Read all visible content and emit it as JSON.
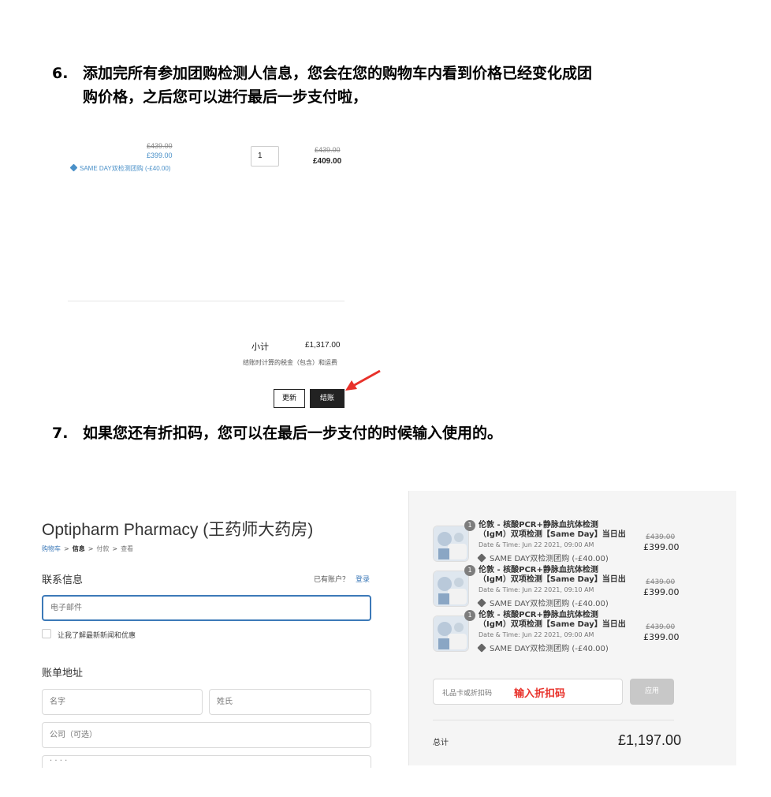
{
  "step6": {
    "number": "6.",
    "line1": "添加完所有参加团购检测人信息，您会在您的购物车内看到价格已经变化成团",
    "line2": "购价格，之后您可以进行最后一步支付啦，"
  },
  "cart": {
    "unit_old_price": "£439.00",
    "unit_new_price": "£399.00",
    "discount_label": "SAME DAY双检测团购 (-£40.00)",
    "quantity": "1",
    "line_old_total": "£439.00",
    "line_new_total": "£409.00",
    "subtotal_label": "小计",
    "subtotal_value": "£1,317.00",
    "tax_note": "结账时计算的税金（包含）和运费",
    "update_label": "更新",
    "checkout_label": "结账"
  },
  "step7": {
    "number": "7.",
    "line1": "如果您还有折扣码，您可以在最后一步支付的时候输入使用的。"
  },
  "checkout": {
    "shop_title": "Optipharm Pharmacy (王药师大药房)",
    "breadcrumb": [
      {
        "label": "购物车",
        "color": "#3c79b8"
      },
      {
        "label": ">",
        "color": "#555"
      },
      {
        "label": "信息",
        "color": "#222"
      },
      {
        "label": ">",
        "color": "#555"
      },
      {
        "label": "付款",
        "color": "#777"
      },
      {
        "label": ">",
        "color": "#555"
      },
      {
        "label": "查看",
        "color": "#777"
      }
    ],
    "contact_heading": "联系信息",
    "have_account": "已有账户？",
    "login_label": "登录",
    "email_placeholder": "电子邮件",
    "newsletter_label": "让我了解最新新闻和优惠",
    "billing_heading": "账单地址",
    "first_name_placeholder": "名字",
    "last_name_placeholder": "姓氏",
    "company_placeholder": "公司（可选）",
    "address_placeholder": "· · · ·"
  },
  "summary": {
    "items": [
      {
        "qty": "1",
        "name_line1": "伦敦 - 核酸PCR+静脉血抗体检测",
        "name_line2": "（IgM）双项检测【Same Day】当日出",
        "date": "Date & Time: Jun 22 2021, 09:00 AM",
        "discount": "SAME DAY双检测团购 (-£40.00)",
        "old_price": "£439.00",
        "new_price": "£399.00"
      },
      {
        "qty": "1",
        "name_line1": "伦敦 - 核酸PCR+静脉血抗体检测",
        "name_line2": "（IgM）双项检测【Same Day】当日出",
        "date": "Date & Time: Jun 22 2021, 09:10 AM",
        "discount": "SAME DAY双检测团购 (-£40.00)",
        "old_price": "£439.00",
        "new_price": "£399.00"
      },
      {
        "qty": "1",
        "name_line1": "伦敦 - 核酸PCR+静脉血抗体检测",
        "name_line2": "（IgM）双项检测【Same Day】当日出",
        "date": "Date & Time: Jun 22 2021, 09:00 AM",
        "discount": "SAME DAY双检测团购 (-£40.00)",
        "old_price": "£439.00",
        "new_price": "£399.00"
      }
    ],
    "discount_placeholder": "礼品卡或折扣码",
    "discount_annotation": "输入折扣码",
    "apply_label": "应用",
    "total_label": "总计",
    "total_value": "£1,197.00"
  },
  "colors": {
    "accent_blue": "#3c79b8",
    "annotation_red": "#e8312a",
    "button_dark": "#222222"
  }
}
